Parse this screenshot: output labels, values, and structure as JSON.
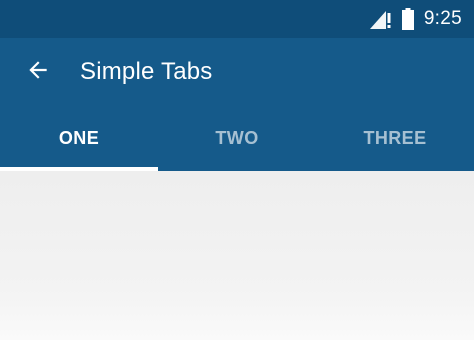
{
  "status_bar": {
    "time": "9:25",
    "signal_icon": "signal-no-data-icon",
    "battery_icon": "battery-full-icon"
  },
  "toolbar": {
    "back_icon": "arrow-back-icon",
    "title": "Simple Tabs"
  },
  "tabs": {
    "items": [
      {
        "label": "ONE",
        "active": true
      },
      {
        "label": "TWO",
        "active": false
      },
      {
        "label": "THREE",
        "active": false
      }
    ]
  },
  "colors": {
    "primary": "#155a8a",
    "primary_dark": "#0f4d79",
    "indicator": "#ffffff",
    "background": "#efefef"
  }
}
